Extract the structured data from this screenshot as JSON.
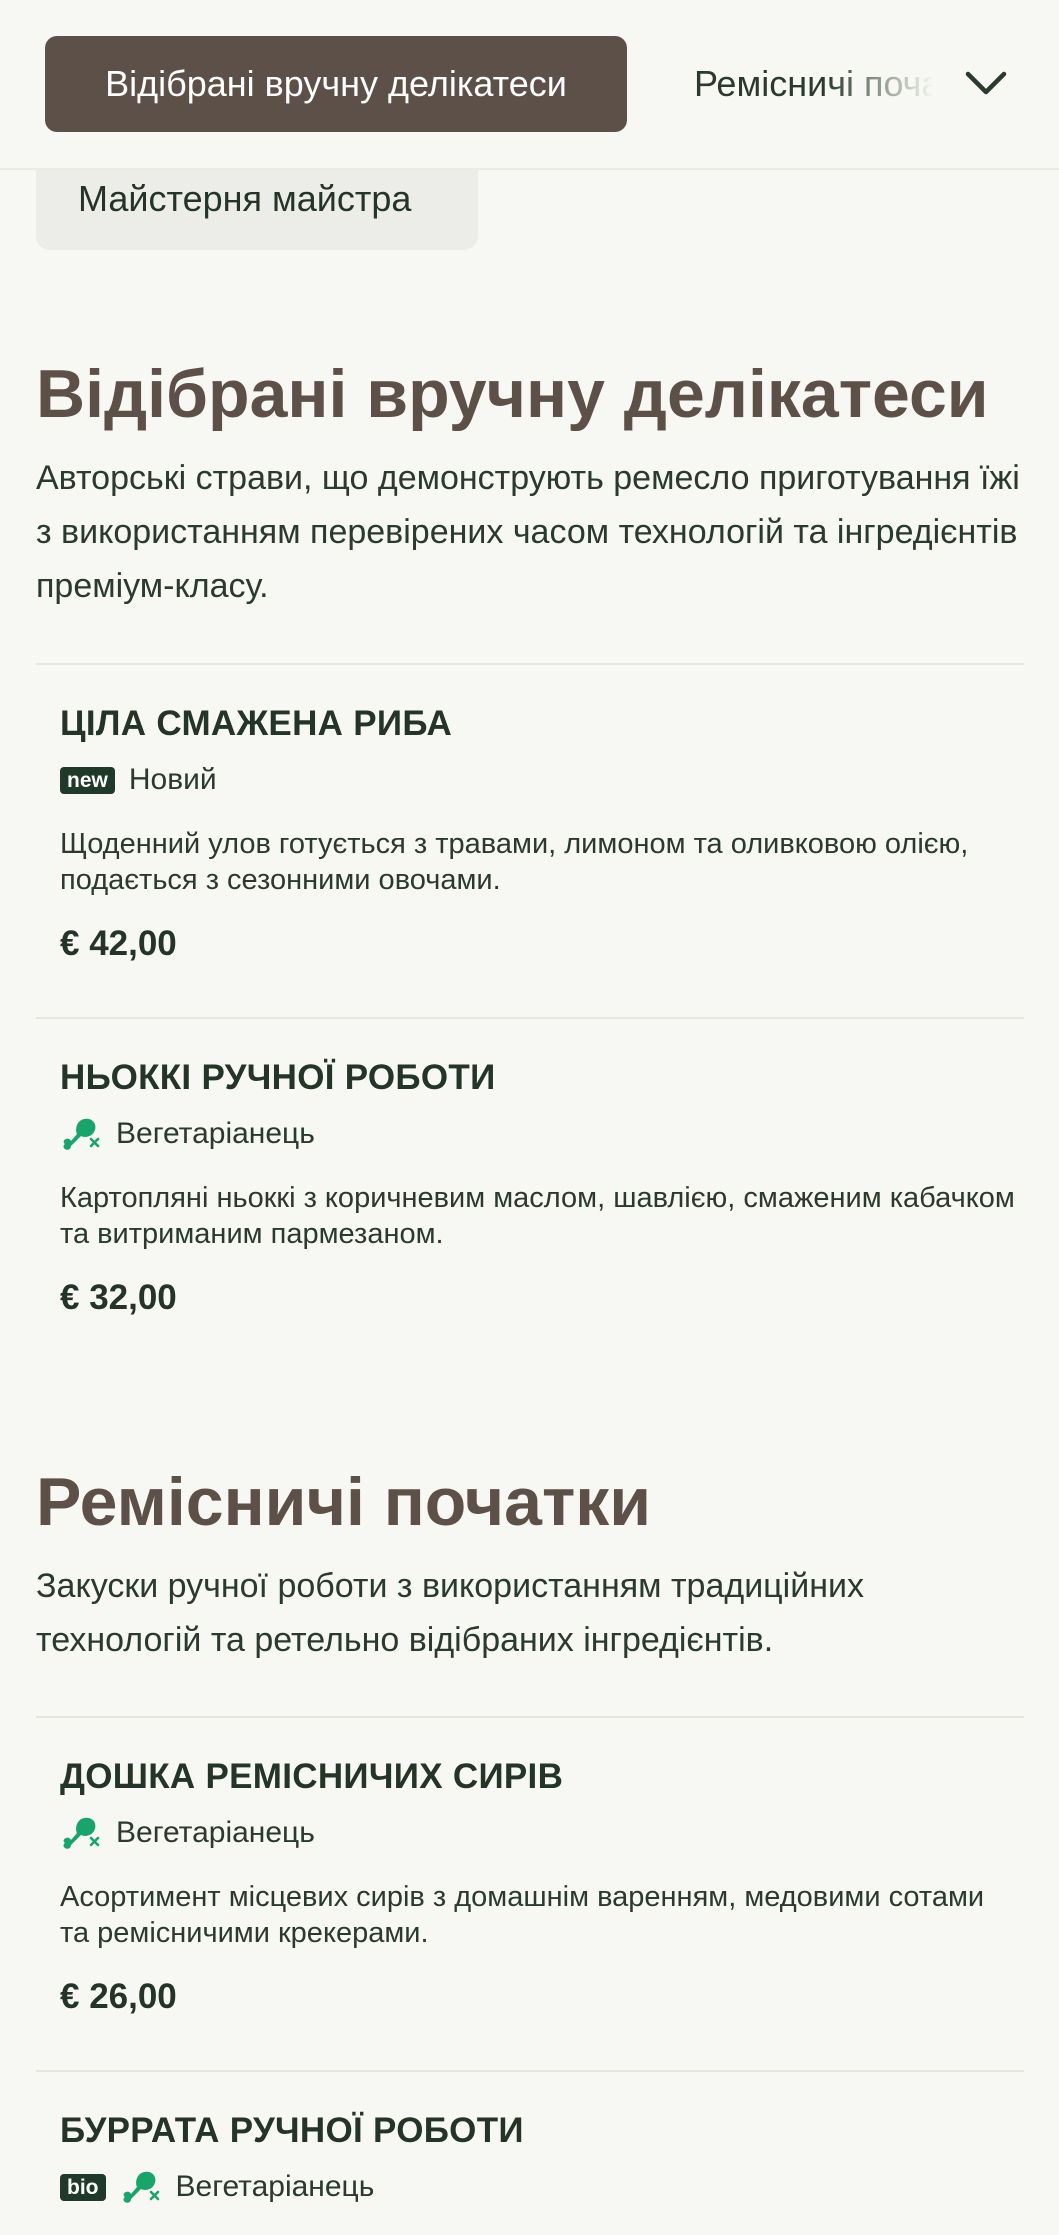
{
  "nav": {
    "active_tab": "Відібрані вручну делікатеси",
    "next_tab": "Ремісничі початки",
    "prev_tab": "Майстерня майстра"
  },
  "sections": [
    {
      "title": "Відібрані вручну делікатеси",
      "description": "Авторські страви, що демонструють ремесло приготування їжі з використанням перевірених часом технологій та інгредієнтів преміум-класу.",
      "items": [
        {
          "name": "ЦІЛА СМАЖЕНА РИБА",
          "badge": "new",
          "tag": "Новий",
          "description": "Щоденний улов готується з травами, лимоном та оливковою олією, подається з сезонними овочами.",
          "price": "€ 42,00"
        },
        {
          "name": "НЬОККІ РУЧНОЇ РОБОТИ",
          "tag": "Вегетаріанець",
          "description": "Картопляні ньоккі з коричневим маслом, шавлією, смаженим кабачком та витриманим пармезаном.",
          "price": "€ 32,00"
        }
      ]
    },
    {
      "title": "Ремісничі початки",
      "description": "Закуски ручної роботи з використанням традиційних технологій та ретельно відібраних інгредієнтів.",
      "items": [
        {
          "name": "ДОШКА РЕМІСНИЧИХ СИРІВ",
          "tag": "Вегетаріанець",
          "description": "Асортимент місцевих сирів з домашнім варенням, медовими сотами та ремісничими крекерами.",
          "price": "€ 26,00"
        },
        {
          "name": "БУРРАТА РУЧНОЇ РОБОТИ",
          "badge": "bio",
          "tag": "Вегетаріанець"
        }
      ]
    }
  ],
  "icons": {
    "next_tab_chevron": "chevron-down-icon",
    "vegetarian": "vegetarian-leg-icon"
  },
  "colors": {
    "background": "#f7f8f3",
    "active_tab": "#5d5048",
    "section_title": "#5d5048",
    "text": "#243426",
    "badge": "#1f3a2a",
    "vegetarian_icon": "#1aa36b"
  }
}
